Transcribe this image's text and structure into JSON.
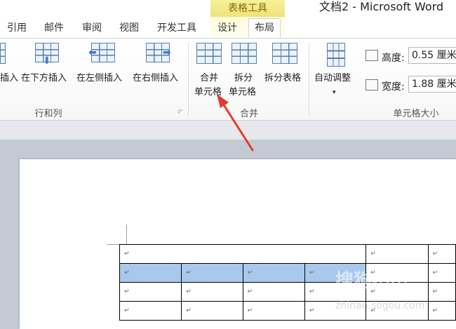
{
  "window": {
    "title": "文档2 - Microsoft Word",
    "context_header": "表格工具"
  },
  "tabs": [
    {
      "label": "引用"
    },
    {
      "label": "邮件"
    },
    {
      "label": "审阅"
    },
    {
      "label": "视图"
    },
    {
      "label": "开发工具"
    },
    {
      "label": "设计"
    },
    {
      "label": "布局"
    }
  ],
  "ribbon": {
    "rows_cols": {
      "group_label": "行和列",
      "insert_above_partial": "插入",
      "insert_below": "在下方插入",
      "insert_left": "在左侧插入",
      "insert_right": "在右侧插入"
    },
    "merge": {
      "group_label": "合并",
      "merge_cells_line1": "合并",
      "merge_cells_line2": "单元格",
      "split_cells_line1": "拆分",
      "split_cells_line2": "单元格",
      "split_table": "拆分表格"
    },
    "cell_size": {
      "group_label": "单元格大小",
      "autofit": "自动调整",
      "autofit_arrow": "▾",
      "height_label": "高度:",
      "height_value": "0.55 厘米",
      "width_label": "宽度:",
      "width_value": "1.88 厘米"
    }
  },
  "document": {
    "paragraph_mark": "↵"
  },
  "watermark": {
    "text": "搜狗指南",
    "url": "zhinan.sogou.com"
  }
}
